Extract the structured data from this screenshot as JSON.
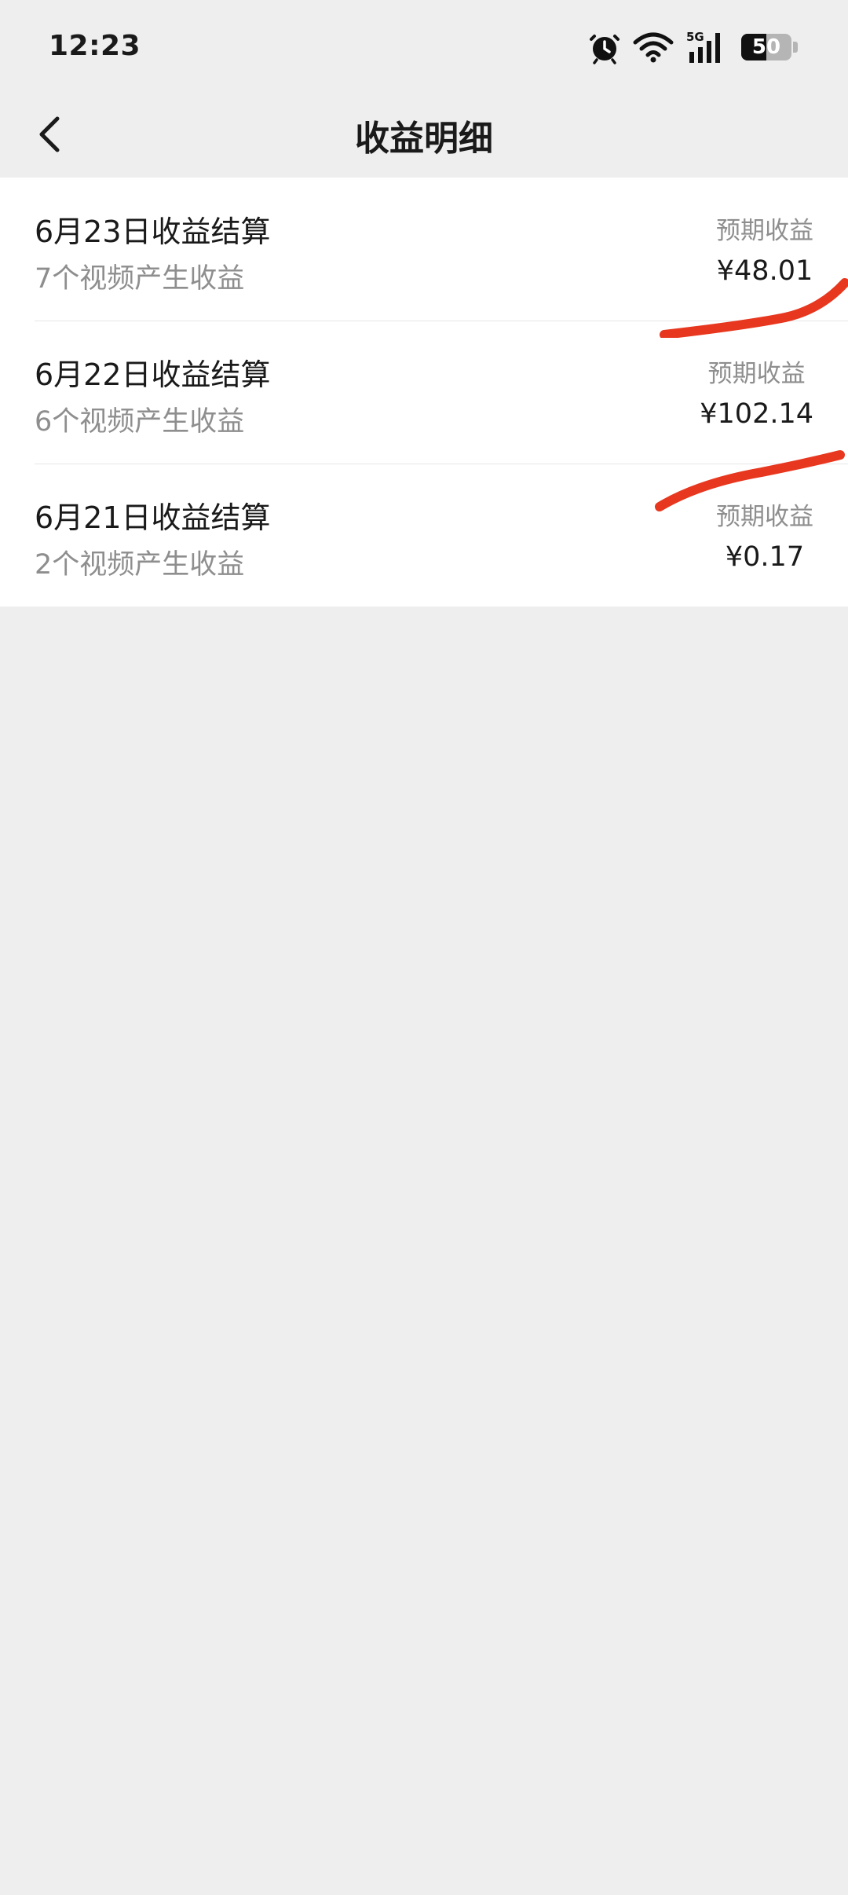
{
  "status_bar": {
    "time": "12:23",
    "network": "5G",
    "battery_level": "50",
    "battery_fraction": 0.5,
    "icons": [
      "alarm-icon",
      "wifi-icon",
      "signal-5g-icon",
      "battery-icon"
    ]
  },
  "nav": {
    "title": "收益明细",
    "back_icon": "chevron-left-icon"
  },
  "income_list": [
    {
      "title": "6月23日收益结算",
      "subtitle": "7个视频产生收益",
      "tag": "预期收益",
      "amount": "¥48.01"
    },
    {
      "title": "6月22日收益结算",
      "subtitle": "6个视频产生收益",
      "tag": "预期收益",
      "amount": "¥102.14"
    },
    {
      "title": "6月21日收益结算",
      "subtitle": "2个视频产生收益",
      "tag": "预期收益",
      "amount": "¥0.17"
    }
  ],
  "colors": {
    "page_background": "#efeeef",
    "card_background": "#ffffff",
    "primary_text": "#1a1a1a",
    "secondary_text": "#8e8e8e",
    "annotation_red": "#e8371f"
  }
}
